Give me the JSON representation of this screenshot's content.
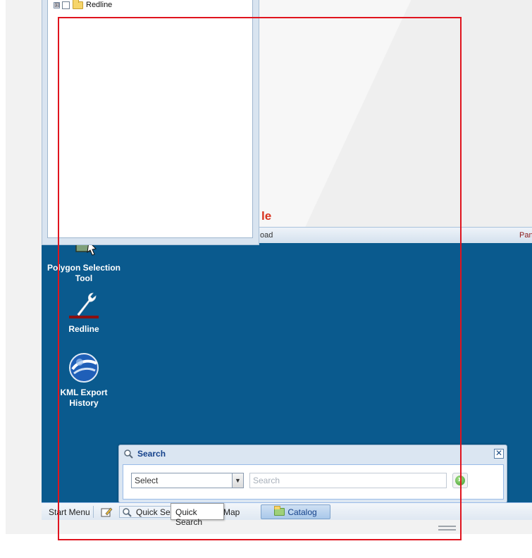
{
  "layer_tree": {
    "items": [
      {
        "label": "Redline",
        "expander": "⊞"
      }
    ]
  },
  "map_header": {
    "title_fragment": "le",
    "left_text": "oad",
    "right_text": "Pan"
  },
  "desktop_icons": [
    {
      "label": "Polygon Selection Tool",
      "icon": "polygon-selection-icon"
    },
    {
      "label": "Redline",
      "icon": "wrench-icon"
    },
    {
      "label": "KML Export History",
      "icon": "google-earth-icon"
    }
  ],
  "search_window": {
    "title": "Search",
    "close_glyph": "✕",
    "select_value": "Select",
    "search_placeholder": "Search"
  },
  "taskbar": {
    "start_menu": "Start Menu",
    "quick_search": "Quick Sear",
    "map": "Map",
    "catalog": "Catalog"
  },
  "tooltip": {
    "text": "Quick Search"
  },
  "colors": {
    "desktop": "#0a5a8e",
    "accent_red": "#e0141e",
    "window_title": "#15428b"
  }
}
